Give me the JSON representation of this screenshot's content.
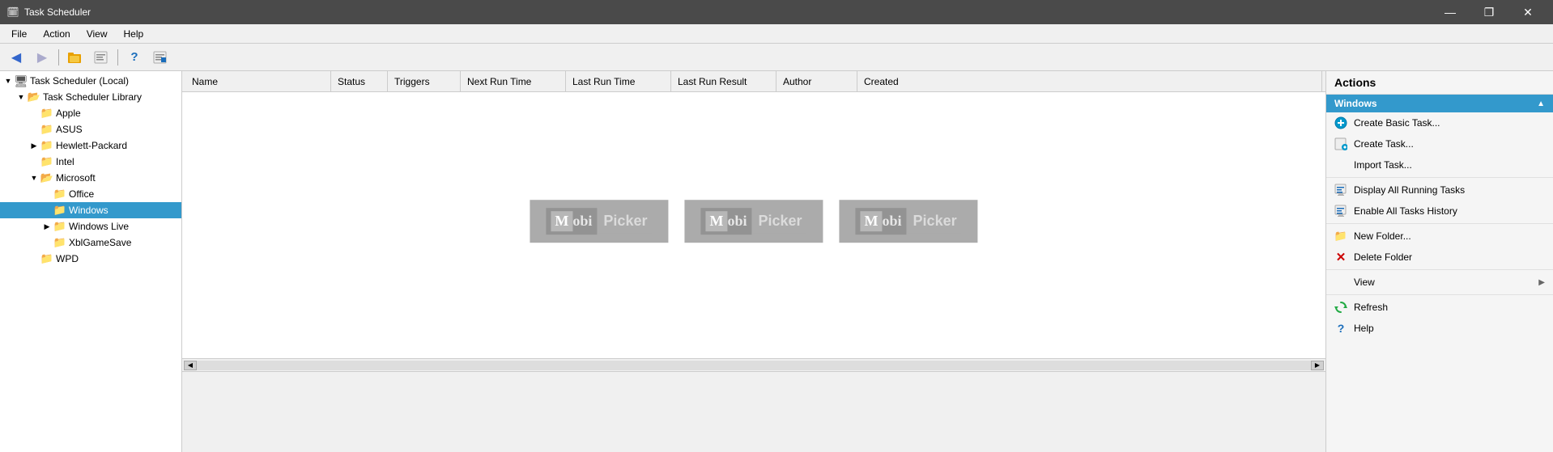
{
  "titleBar": {
    "title": "Task Scheduler",
    "icon": "🗓",
    "controls": {
      "minimize": "—",
      "maximize": "❐",
      "close": "✕"
    }
  },
  "menuBar": {
    "items": [
      "File",
      "Action",
      "View",
      "Help"
    ]
  },
  "toolbar": {
    "buttons": [
      {
        "name": "back",
        "icon": "◀",
        "label": "Back"
      },
      {
        "name": "forward",
        "icon": "▶",
        "label": "Forward"
      },
      {
        "name": "up",
        "icon": "📂",
        "label": "Up"
      },
      {
        "name": "show-hide",
        "icon": "📋",
        "label": "Show/Hide"
      },
      {
        "name": "help",
        "icon": "❓",
        "label": "Help"
      },
      {
        "name": "export",
        "icon": "📋",
        "label": "Export"
      }
    ]
  },
  "tree": {
    "root": {
      "label": "Task Scheduler (Local)",
      "icon": "computer"
    },
    "items": [
      {
        "label": "Task Scheduler Library",
        "level": 1,
        "expanded": true,
        "hasArrow": true
      },
      {
        "label": "Apple",
        "level": 2,
        "expanded": false,
        "hasArrow": false
      },
      {
        "label": "ASUS",
        "level": 2,
        "expanded": false,
        "hasArrow": false
      },
      {
        "label": "Hewlett-Packard",
        "level": 2,
        "expanded": false,
        "hasArrow": true
      },
      {
        "label": "Intel",
        "level": 2,
        "expanded": false,
        "hasArrow": false
      },
      {
        "label": "Microsoft",
        "level": 2,
        "expanded": true,
        "hasArrow": true
      },
      {
        "label": "Office",
        "level": 3,
        "expanded": false,
        "hasArrow": false
      },
      {
        "label": "Windows",
        "level": 3,
        "expanded": false,
        "hasArrow": false,
        "selected": true
      },
      {
        "label": "Windows Live",
        "level": 3,
        "expanded": false,
        "hasArrow": true
      },
      {
        "label": "XblGameSave",
        "level": 3,
        "expanded": false,
        "hasArrow": false
      },
      {
        "label": "WPD",
        "level": 2,
        "expanded": false,
        "hasArrow": false
      }
    ]
  },
  "tableColumns": [
    "Name",
    "Status",
    "Triggers",
    "Next Run Time",
    "Last Run Time",
    "Last Run Result",
    "Author",
    "Created"
  ],
  "actions": {
    "header": "Actions",
    "sections": [
      {
        "title": "Windows",
        "items": [
          {
            "label": "Create Basic Task...",
            "icon": "⚙",
            "iconColor": "cyan",
            "hasArrow": false
          },
          {
            "label": "Create Task...",
            "icon": "📋",
            "iconColor": "cyan",
            "hasArrow": false
          },
          {
            "label": "Import Task...",
            "icon": "",
            "iconColor": "gray",
            "hasArrow": false
          },
          {
            "label": "Display All Running Tasks",
            "icon": "📋",
            "iconColor": "blue",
            "hasArrow": false
          },
          {
            "label": "Enable All Tasks History",
            "icon": "📋",
            "iconColor": "blue",
            "hasArrow": false
          },
          {
            "label": "New Folder...",
            "icon": "📁",
            "iconColor": "yellow",
            "hasArrow": false
          },
          {
            "label": "Delete Folder",
            "icon": "✕",
            "iconColor": "red",
            "hasArrow": false
          },
          {
            "label": "View",
            "icon": "",
            "iconColor": "gray",
            "hasArrow": true
          },
          {
            "label": "Refresh",
            "icon": "🔄",
            "iconColor": "green",
            "hasArrow": false
          },
          {
            "label": "Help",
            "icon": "❓",
            "iconColor": "blue",
            "hasArrow": false
          }
        ]
      }
    ]
  },
  "watermark": {
    "text": "MobiPicker",
    "repeat": 3
  }
}
